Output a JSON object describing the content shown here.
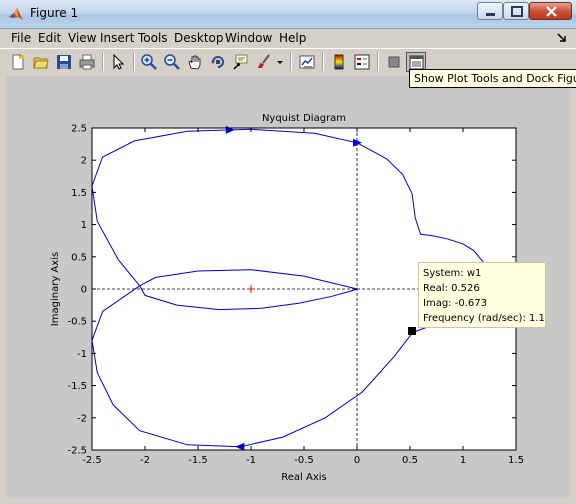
{
  "window": {
    "title": "Figure 1"
  },
  "menu": {
    "items": [
      "File",
      "Edit",
      "View",
      "Insert",
      "Tools",
      "Desktop",
      "Window",
      "Help"
    ]
  },
  "toolbar": {
    "icons": [
      "new-figure-icon",
      "open-file-icon",
      "save-icon",
      "print-icon",
      "pointer-icon",
      "zoom-in-icon",
      "zoom-out-icon",
      "pan-icon",
      "rotate-3d-icon",
      "data-cursor-icon",
      "brush-icon",
      "link-plot-icon",
      "colorbar-icon",
      "legend-icon",
      "hide-plot-tools-icon",
      "show-plot-tools-icon"
    ]
  },
  "tooltip": {
    "text": "Show Plot Tools and Dock Figure"
  },
  "chart_data": {
    "type": "line",
    "title": "Nyquist Diagram",
    "xlabel": "Real Axis",
    "ylabel": "Imaginary Axis",
    "xlim": [
      -2.5,
      1.5
    ],
    "ylim": [
      -2.5,
      2.5
    ],
    "xticks": [
      "-2.5",
      "-2",
      "-1.5",
      "-1",
      "-0.5",
      "0",
      "0.5",
      "1",
      "1.5"
    ],
    "yticks": [
      "2.5",
      "2",
      "1.5",
      "1",
      "0.5",
      "0",
      "-0.5",
      "-1",
      "-1.5",
      "-2",
      "-2.5"
    ],
    "critical_point": [
      -1,
      0
    ],
    "series": [
      {
        "color": "#0000cc",
        "x": [
          0,
          -0.5,
          -1,
          -1.5,
          -1.9,
          -2.05,
          -2.0,
          -1.7,
          -1.3,
          -0.9,
          -0.55,
          -0.25,
          -0.05,
          0
        ],
        "y": [
          0,
          0.2,
          0.3,
          0.28,
          0.18,
          0.05,
          -0.1,
          -0.25,
          -0.32,
          -0.3,
          -0.22,
          -0.12,
          -0.03,
          0
        ]
      },
      {
        "color": "#0000cc",
        "x": [
          -2.05,
          -2.25,
          -2.45,
          -2.5,
          -2.4,
          -2.1,
          -1.6,
          -1.0,
          -0.4,
          0.0,
          0.28,
          0.43,
          0.52
        ],
        "y": [
          0.05,
          0.45,
          1.05,
          1.6,
          2.05,
          2.3,
          2.45,
          2.48,
          2.42,
          2.27,
          2.02,
          1.78,
          1.48
        ]
      },
      {
        "color": "#0000cc",
        "x": [
          0.52,
          0.55,
          0.6,
          0.7,
          0.85,
          1.0,
          1.1,
          1.2,
          1.18,
          1.05,
          0.85,
          0.65,
          0.526,
          0.35,
          0.05,
          -0.3,
          -0.7,
          -1.1,
          -1.6,
          -2.05,
          -2.3,
          -2.45,
          -2.5,
          -2.4,
          -2.05
        ],
        "y": [
          1.48,
          1.1,
          0.85,
          0.83,
          0.78,
          0.7,
          0.6,
          0.4,
          0.1,
          -0.2,
          -0.45,
          -0.6,
          -0.673,
          -1.05,
          -1.6,
          -2.0,
          -2.3,
          -2.45,
          -2.42,
          -2.2,
          -1.8,
          -1.3,
          -0.8,
          -0.35,
          0.05
        ]
      }
    ],
    "arrows": [
      {
        "x": -1.2,
        "y": 2.47,
        "dir": 1
      },
      {
        "x": -1.1,
        "y": -2.45,
        "dir": -1
      },
      {
        "x": 0,
        "y": 2.27,
        "dir": 1
      }
    ],
    "datatip": {
      "point": [
        0.526,
        -0.673
      ],
      "lines": [
        "System: w1",
        "Real: 0.526",
        "Imag: -0.673",
        "Frequency (rad/sec): 1.1"
      ]
    }
  }
}
